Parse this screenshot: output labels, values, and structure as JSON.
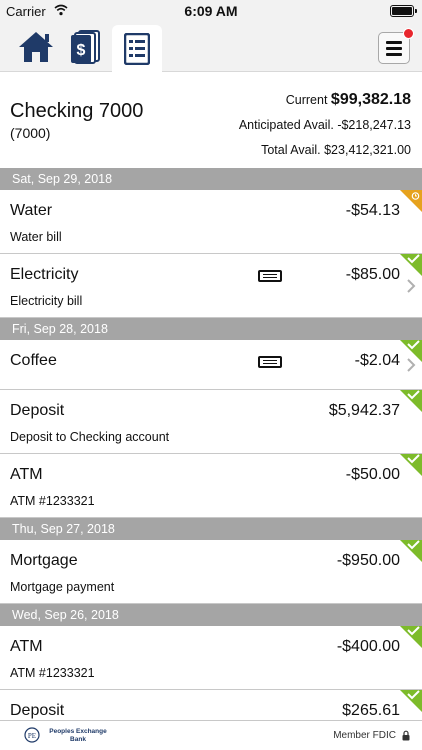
{
  "status_bar": {
    "carrier": "Carrier",
    "time": "6:09 AM"
  },
  "nav": {
    "tabs": [
      {
        "name": "home",
        "icon": "home-icon"
      },
      {
        "name": "accounts",
        "icon": "money-stack-icon"
      },
      {
        "name": "register",
        "icon": "register-icon"
      }
    ],
    "active_tab": "register",
    "menu_icon": "hamburger-icon"
  },
  "account": {
    "name": "Checking 7000",
    "number": "(7000)",
    "current_label": "Current",
    "current_value": "$99,382.18",
    "anticipated_label": "Anticipated Avail.",
    "anticipated_value": "-$218,247.13",
    "total_label": "Total Avail.",
    "total_value": "$23,412,321.00"
  },
  "transactions": [
    {
      "date": "Sat, Sep 29, 2018",
      "items": [
        {
          "name": "Water",
          "description": "Water bill",
          "amount": "-$54.13",
          "status": "pending"
        },
        {
          "name": "Electricity",
          "description": "Electricity bill",
          "amount": "-$85.00",
          "status": "cleared",
          "memo": true,
          "chevron": true
        }
      ]
    },
    {
      "date": "Fri, Sep 28, 2018",
      "items": [
        {
          "name": "Coffee",
          "description": "",
          "amount": "-$2.04",
          "status": "cleared",
          "memo": true,
          "chevron": true
        },
        {
          "name": "Deposit",
          "description": "Deposit to Checking account",
          "amount": "$5,942.37",
          "status": "cleared"
        },
        {
          "name": "ATM",
          "description": "ATM #1233321",
          "amount": "-$50.00",
          "status": "cleared"
        }
      ]
    },
    {
      "date": "Thu, Sep 27, 2018",
      "items": [
        {
          "name": "Mortgage",
          "description": "Mortgage payment",
          "amount": "-$950.00",
          "status": "cleared"
        }
      ]
    },
    {
      "date": "Wed, Sep 26, 2018",
      "items": [
        {
          "name": "ATM",
          "description": "ATM #1233321",
          "amount": "-$400.00",
          "status": "cleared"
        },
        {
          "name": "Deposit",
          "description": "",
          "amount": "$265.61",
          "status": "cleared"
        }
      ]
    }
  ],
  "footer": {
    "bank_name_line1": "Peoples Exchange",
    "bank_name_line2": "Bank",
    "member": "Member FDIC"
  },
  "colors": {
    "cleared": "#7dbb2a",
    "pending": "#e6a21e",
    "date_header": "#a5a5a5",
    "nav_icon": "#1f3a68"
  }
}
